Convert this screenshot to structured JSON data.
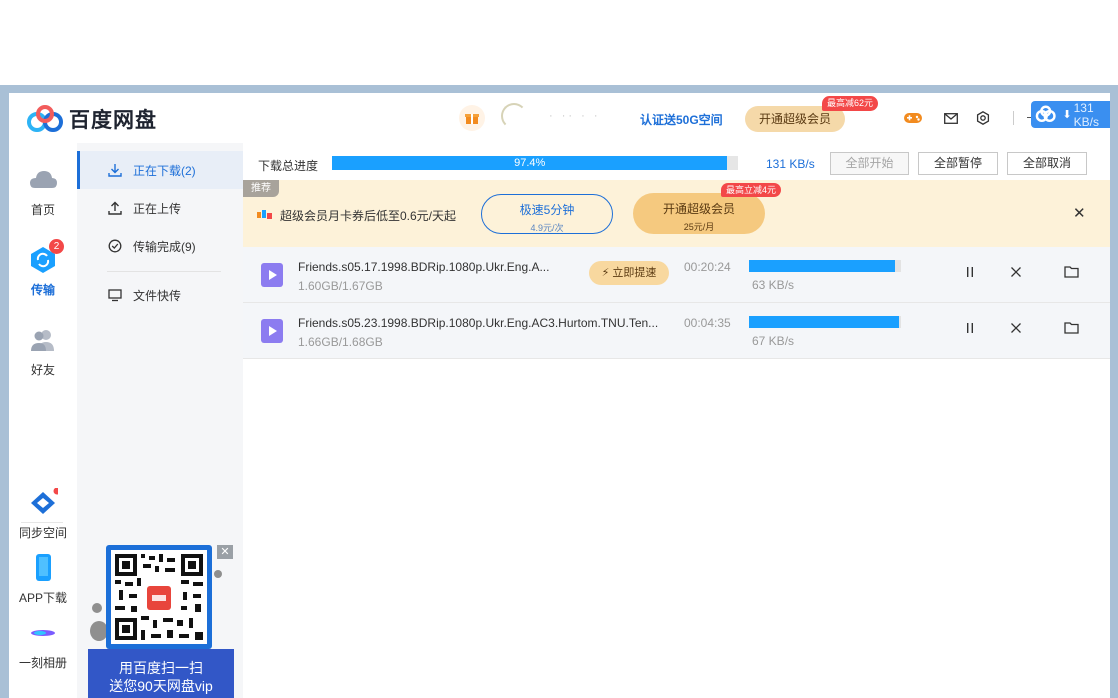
{
  "app": {
    "title": "百度网盘",
    "verify_link": "认证送50G空间",
    "vip_button": "开通超级会员",
    "vip_badge": "最高减62元",
    "username_masked": "· ·· · ·",
    "float_speed": "131 KB/s"
  },
  "rail": {
    "items": [
      {
        "label": "首页",
        "icon": "cloud-icon"
      },
      {
        "label": "传输",
        "icon": "transfer-icon",
        "badge": "2"
      },
      {
        "label": "好友",
        "icon": "friends-icon"
      },
      {
        "label": "同步空间",
        "icon": "sync-icon"
      },
      {
        "label": "APP下载",
        "icon": "phone-icon"
      },
      {
        "label": "一刻相册",
        "icon": "album-icon"
      }
    ]
  },
  "sidebar": {
    "items": [
      {
        "label": "正在下载(2)",
        "icon": "download-icon"
      },
      {
        "label": "正在上传",
        "icon": "upload-icon"
      },
      {
        "label": "传输完成(9)",
        "icon": "check-circle-icon"
      },
      {
        "label": "文件快传",
        "icon": "monitor-icon"
      }
    ],
    "promo_line1": "用百度扫一扫",
    "promo_line2": "送您90天网盘vip",
    "promo_close": "✕"
  },
  "toolbar": {
    "progress_label": "下载总进度",
    "progress_percent": 97.4,
    "progress_text": "97.4%",
    "speed": "131 KB/s",
    "start_all": "全部开始",
    "pause_all": "全部暂停",
    "cancel_all": "全部取消"
  },
  "ad": {
    "tag": "推荐",
    "text": "超级会员月卡券后低至0.6元/天起",
    "btn1_main": "极速5分钟",
    "btn1_sub": "4.9元/次",
    "btn2_main": "开通超级会员",
    "btn2_sub": "25元/月",
    "btn2_badge": "最高立减4元",
    "close": "✕"
  },
  "tasks": [
    {
      "name": "Friends.s05.17.1998.BDRip.1080p.Ukr.Eng.A...",
      "size": "1.60GB/1.67GB",
      "accel": "⚡ 立即提速",
      "eta": "00:20:24",
      "progress": 0.958,
      "speed": "63 KB/s"
    },
    {
      "name": "Friends.s05.23.1998.BDRip.1080p.Ukr.Eng.AC3.Hurtom.TNU.Ten...",
      "size": "1.66GB/1.68GB",
      "accel": "",
      "eta": "00:04:35",
      "progress": 0.988,
      "speed": "67 KB/s"
    }
  ],
  "colors": {
    "accent": "#1d6fd8",
    "progress": "#1aa0ff",
    "vip_gold": "#f5d9a9",
    "badge_red": "#f34848"
  }
}
